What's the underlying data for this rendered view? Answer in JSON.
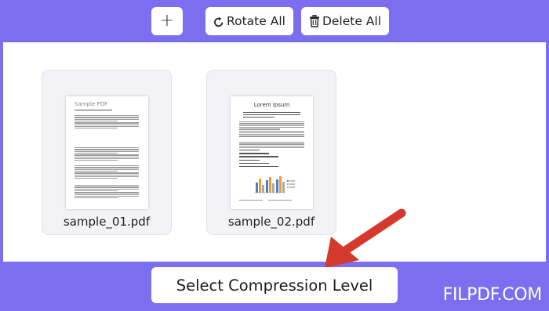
{
  "toolbar": {
    "add_label": "+",
    "rotate_label": "Rotate All",
    "delete_label": "Delete All"
  },
  "files": [
    {
      "name": "sample_01.pdf",
      "thumb_title": "Sample PDF"
    },
    {
      "name": "sample_02.pdf",
      "thumb_title": "Lorem Ipsum"
    }
  ],
  "compress_button": {
    "label": "Select Compression Level"
  },
  "watermark": "FILPDF.COM",
  "colors": {
    "background": "#7b6ff0",
    "workspace": "#ffffff",
    "arrow": "#d4392b",
    "chart_orange": "#f29b2e",
    "chart_blue": "#4d7fc4",
    "chart_gray": "#a9a9a9"
  }
}
